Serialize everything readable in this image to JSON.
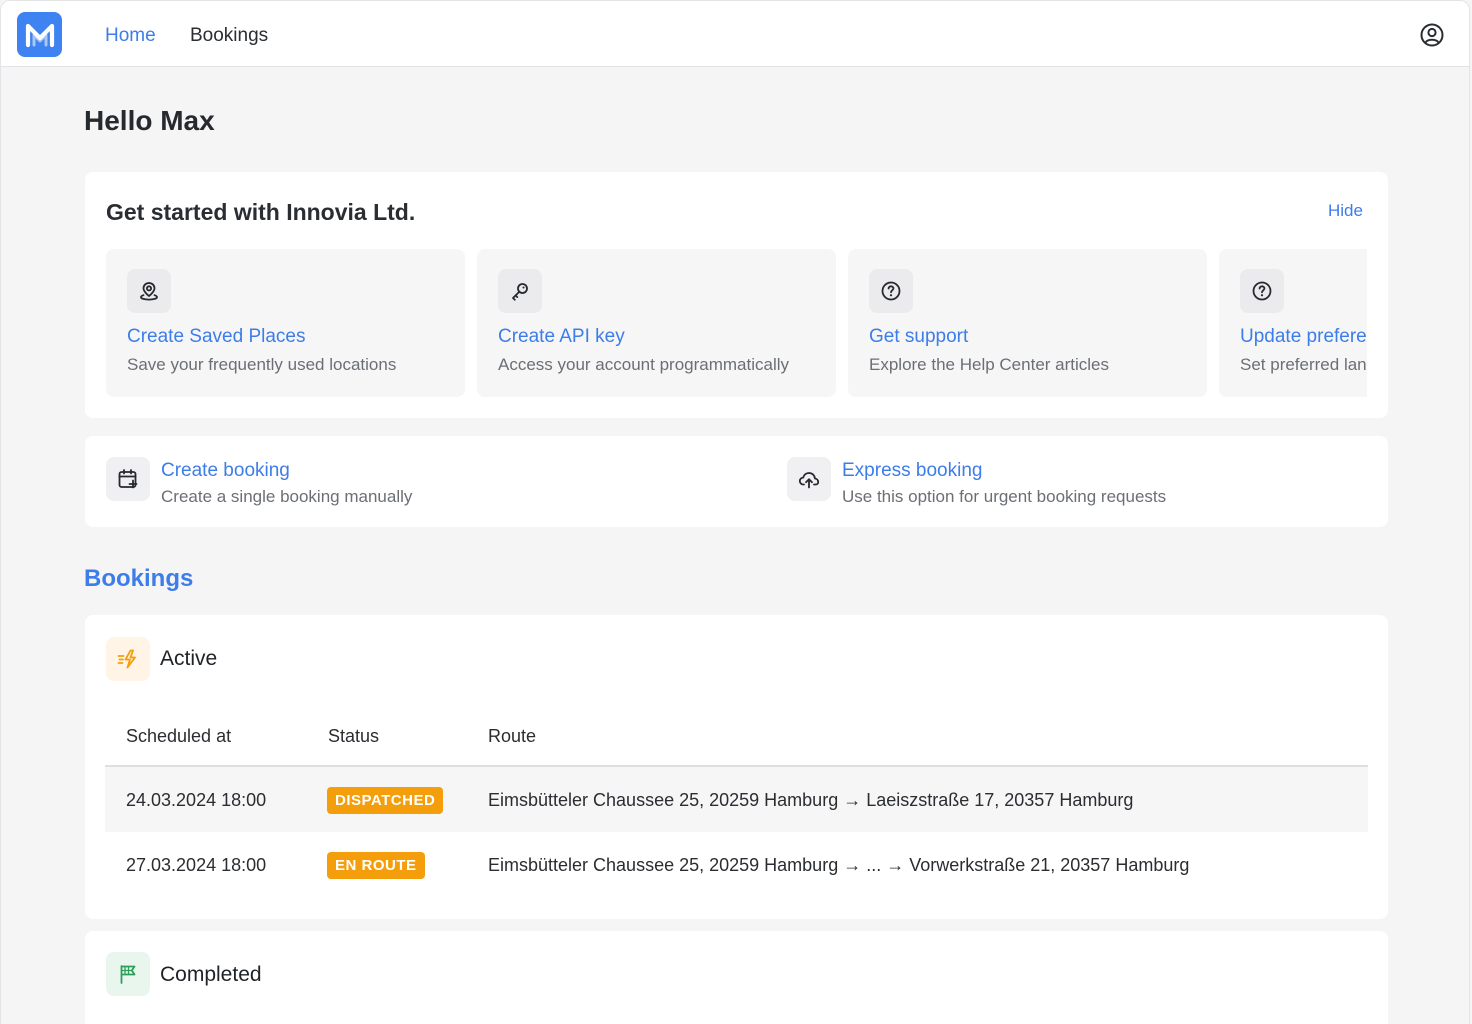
{
  "nav": {
    "logo_letter": "M",
    "home_label": "Home",
    "bookings_label": "Bookings"
  },
  "greeting": "Hello Max",
  "get_started": {
    "title": "Get started with Innovia Ltd.",
    "hide_label": "Hide",
    "tiles": [
      {
        "icon": "map-pin-icon",
        "title": "Create Saved Places",
        "desc": "Save your frequently used locations"
      },
      {
        "icon": "key-icon",
        "title": "Create API key",
        "desc": "Access your account programmatically"
      },
      {
        "icon": "help-circle-icon",
        "title": "Get support",
        "desc": "Explore the Help Center articles"
      },
      {
        "icon": "help-circle-icon",
        "title": "Update preferences",
        "desc": "Set preferred language"
      }
    ]
  },
  "quick_actions": [
    {
      "icon": "calendar-plus-icon",
      "title": "Create booking",
      "desc": "Create a single booking manually"
    },
    {
      "icon": "cloud-upload-icon",
      "title": "Express booking",
      "desc": "Use this option for urgent booking requests"
    }
  ],
  "bookings": {
    "heading": "Bookings",
    "active": {
      "title": "Active",
      "columns": [
        "Scheduled at",
        "Status",
        "Route"
      ],
      "rows": [
        {
          "scheduled": "24.03.2024 18:00",
          "status": "DISPATCHED",
          "route": "Eimsbütteler Chaussee 25, 20259 Hamburg → Laeiszstraße 17, 20357 Hamburg"
        },
        {
          "scheduled": "27.03.2024 18:00",
          "status": "EN ROUTE",
          "route": "Eimsbütteler Chaussee 25, 20259 Hamburg → ... → Vorwerkstraße 21, 20357 Hamburg"
        }
      ]
    },
    "completed": {
      "title": "Completed"
    }
  },
  "colors": {
    "accent": "#3d7de9",
    "logo_bg": "#3f82f2",
    "status_badge": "#f59e0b",
    "active_icon_bg": "#fff4e5",
    "completed_icon_bg": "#e9f6ee"
  }
}
